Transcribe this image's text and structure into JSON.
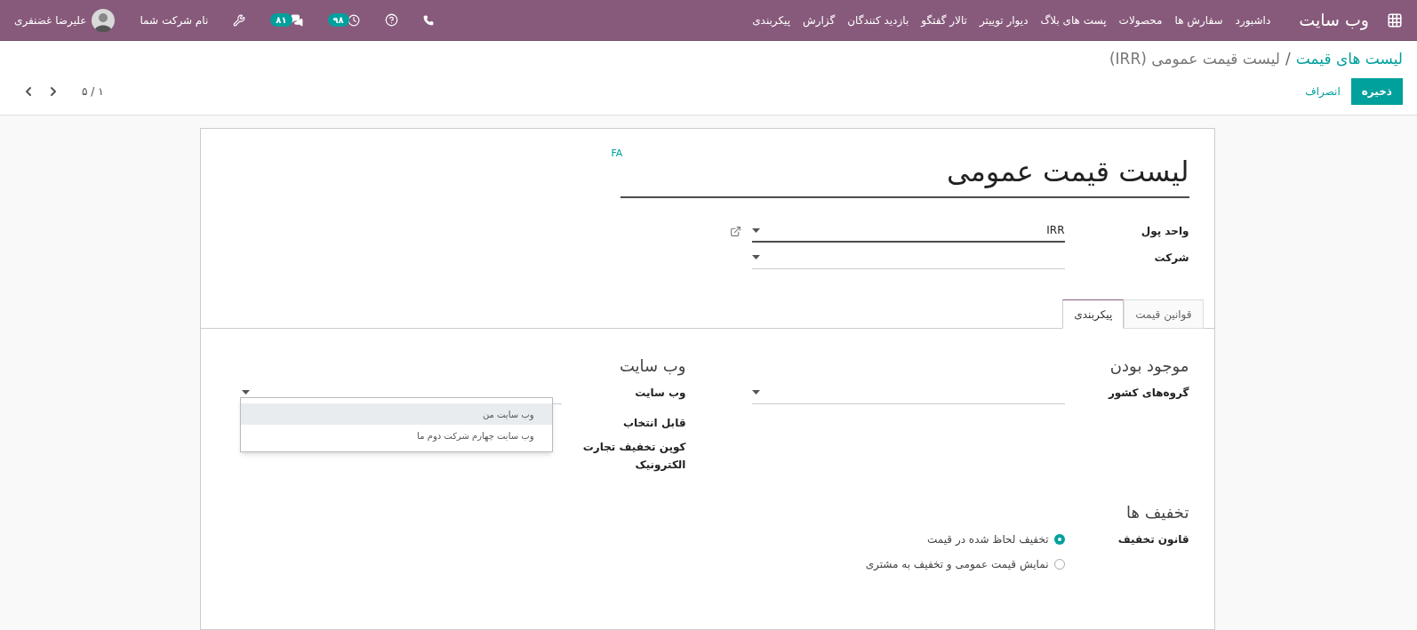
{
  "navbar": {
    "app_title": "وب سایت",
    "menu": [
      "داشبورد",
      "سفارش ها",
      "محصولات",
      "پست های بلاگ",
      "دیوار توییتر",
      "تالار گفتگو",
      "بازدید کنندگان",
      "گزارش",
      "پیکربندی"
    ],
    "activity_count": "۹۸",
    "message_count": "۸۱",
    "company": "نام شرکت شما",
    "user": "علیرضا غضنفری"
  },
  "breadcrumb": {
    "parent": "لیست های قیمت",
    "separator": "/",
    "current": "لیست قیمت عمومی (IRR)"
  },
  "buttons": {
    "save": "ذخیره",
    "discard": "انصراف"
  },
  "pager": "۱ / ۵",
  "form": {
    "title": "لیست قیمت عمومی",
    "language": "FA",
    "fields": [
      {
        "label": "واحد پول",
        "value": "IRR",
        "focused": true,
        "external_link": true
      },
      {
        "label": "شرکت",
        "focused": false,
        "external_link": false
      }
    ],
    "tabs": [
      {
        "label": "قوانین قیمت",
        "selected": false
      },
      {
        "label": "پیکربندی",
        "selected": true
      }
    ],
    "availability": {
      "title": "موجود بودن",
      "label": "گروه‌های کشور"
    },
    "website": {
      "title": "وب سایت",
      "label": "وب سایت",
      "options": [
        {
          "label": "وب سایت من",
          "selected": true
        },
        {
          "label": "وب سایت چهارم شرکت دوم ما",
          "selected": false
        }
      ],
      "selectable_label": "قابل انتخاب",
      "coupon_label": "کوپن تخفیف تجارت الکترونیک"
    },
    "discounts": {
      "title": "تخفیف ها",
      "label": "قانون تخفیف",
      "options": [
        {
          "label": "تخفیف لحاظ شده در قیمت",
          "selected": true
        },
        {
          "label": "نمایش قیمت عمومی و تخفیف به مشتری",
          "selected": false
        }
      ]
    }
  }
}
